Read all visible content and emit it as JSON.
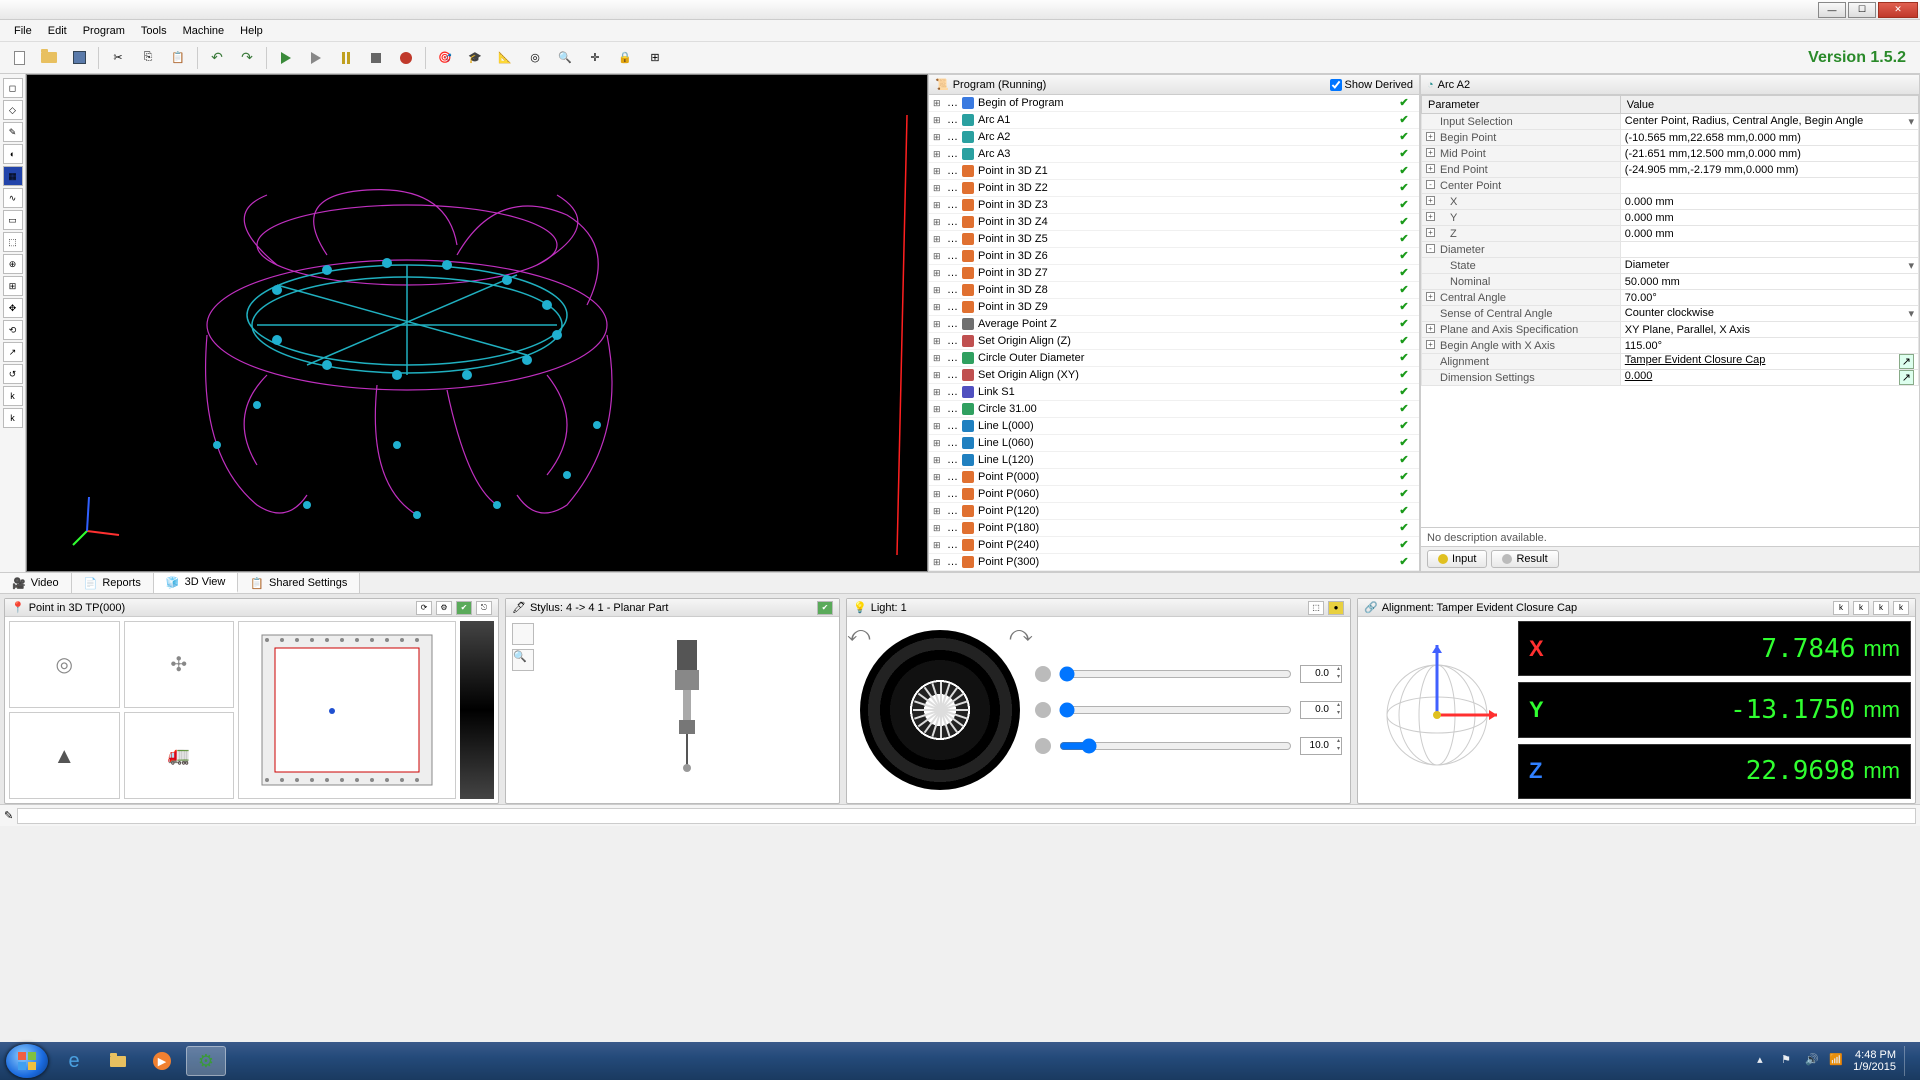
{
  "window": {
    "min": "—",
    "max": "☐",
    "close": "✕"
  },
  "menu": [
    "File",
    "Edit",
    "Program",
    "Tools",
    "Machine",
    "Help"
  ],
  "version": "Version 1.5.2",
  "prog_panel": {
    "title": "Program (Running)",
    "show_derived": "Show Derived",
    "items": [
      {
        "icon": "flag",
        "label": "Begin of Program"
      },
      {
        "icon": "arc",
        "label": "Arc A1"
      },
      {
        "icon": "arc",
        "label": "Arc A2"
      },
      {
        "icon": "arc",
        "label": "Arc A3"
      },
      {
        "icon": "pt",
        "label": "Point in 3D Z1"
      },
      {
        "icon": "pt",
        "label": "Point in 3D Z2"
      },
      {
        "icon": "pt",
        "label": "Point in 3D Z3"
      },
      {
        "icon": "pt",
        "label": "Point in 3D Z4"
      },
      {
        "icon": "pt",
        "label": "Point in 3D Z5"
      },
      {
        "icon": "pt",
        "label": "Point in 3D Z6"
      },
      {
        "icon": "pt",
        "label": "Point in 3D Z7"
      },
      {
        "icon": "pt",
        "label": "Point in 3D Z8"
      },
      {
        "icon": "pt",
        "label": "Point in 3D Z9"
      },
      {
        "icon": "avg",
        "label": "Average Point Z"
      },
      {
        "icon": "org",
        "label": "Set Origin Align (Z)"
      },
      {
        "icon": "cir",
        "label": "Circle Outer Diameter"
      },
      {
        "icon": "org",
        "label": "Set Origin Align (XY)"
      },
      {
        "icon": "lnk",
        "label": "Link S1"
      },
      {
        "icon": "cir",
        "label": "Circle 31.00"
      },
      {
        "icon": "lin",
        "label": "Line L(000)"
      },
      {
        "icon": "lin",
        "label": "Line L(060)"
      },
      {
        "icon": "lin",
        "label": "Line L(120)"
      },
      {
        "icon": "pt",
        "label": "Point P(000)"
      },
      {
        "icon": "pt",
        "label": "Point P(060)"
      },
      {
        "icon": "pt",
        "label": "Point P(120)"
      },
      {
        "icon": "pt",
        "label": "Point P(180)"
      },
      {
        "icon": "pt",
        "label": "Point P(240)"
      },
      {
        "icon": "pt",
        "label": "Point P(300)"
      }
    ]
  },
  "params": {
    "title": "Arc A2",
    "col_param": "Parameter",
    "col_value": "Value",
    "rows": [
      {
        "name": "Input Selection",
        "val": "Center Point, Radius, Central Angle, Begin Angle",
        "exp": "",
        "lvl": 0,
        "drop": true
      },
      {
        "name": "Begin Point",
        "val": "(-10.565 mm,22.658 mm,0.000 mm)",
        "exp": "+",
        "lvl": 0
      },
      {
        "name": "Mid Point",
        "val": "(-21.651 mm,12.500 mm,0.000 mm)",
        "exp": "+",
        "lvl": 0
      },
      {
        "name": "End Point",
        "val": "(-24.905 mm,-2.179 mm,0.000 mm)",
        "exp": "+",
        "lvl": 0
      },
      {
        "name": "Center Point",
        "val": "",
        "exp": "-",
        "lvl": 0
      },
      {
        "name": "X",
        "val": "0.000 mm",
        "exp": "+",
        "lvl": 1
      },
      {
        "name": "Y",
        "val": "0.000 mm",
        "exp": "+",
        "lvl": 1
      },
      {
        "name": "Z",
        "val": "0.000 mm",
        "exp": "+",
        "lvl": 1
      },
      {
        "name": "Diameter",
        "val": "",
        "exp": "-",
        "lvl": 0
      },
      {
        "name": "State",
        "val": "Diameter",
        "exp": "",
        "lvl": 1,
        "drop": true
      },
      {
        "name": "Nominal",
        "val": "50.000 mm",
        "exp": "",
        "lvl": 1
      },
      {
        "name": "Central Angle",
        "val": "70.00°",
        "exp": "+",
        "lvl": 0
      },
      {
        "name": "Sense of Central Angle",
        "val": "Counter clockwise",
        "exp": "",
        "lvl": 0,
        "drop": true
      },
      {
        "name": "Plane and Axis Specification",
        "val": "XY Plane, Parallel, X Axis",
        "exp": "+",
        "lvl": 0
      },
      {
        "name": "Begin Angle with X Axis",
        "val": "115.00°",
        "exp": "+",
        "lvl": 0
      },
      {
        "name": "Alignment",
        "val": "Tamper Evident Closure Cap",
        "exp": "",
        "lvl": 0,
        "link": true,
        "btn": true
      },
      {
        "name": "Dimension Settings",
        "val": "0.000",
        "exp": "",
        "lvl": 0,
        "link": true,
        "btn": true
      }
    ],
    "desc": "No description available.",
    "tab_input": "Input",
    "tab_result": "Result"
  },
  "viewtabs": {
    "video": "Video",
    "reports": "Reports",
    "view3d": "3D View",
    "shared": "Shared Settings"
  },
  "dock": {
    "d1_title": "Point in 3D TP(000)",
    "d2_title": "Stylus: 4 -> 4 1 - Planar Part",
    "d3_title": "Light: 1",
    "d4_title": "Alignment: Tamper Evident Closure Cap",
    "sliders": [
      {
        "val": "0.0"
      },
      {
        "val": "0.0"
      },
      {
        "val": "10.0"
      }
    ]
  },
  "dro": {
    "x": {
      "axis": "X",
      "val": "7.7846",
      "unit": "mm"
    },
    "y": {
      "axis": "Y",
      "val": "-13.1750",
      "unit": "mm"
    },
    "z": {
      "axis": "Z",
      "val": "22.9698",
      "unit": "mm"
    }
  },
  "clock": {
    "time": "4:48 PM",
    "date": "1/9/2015"
  }
}
